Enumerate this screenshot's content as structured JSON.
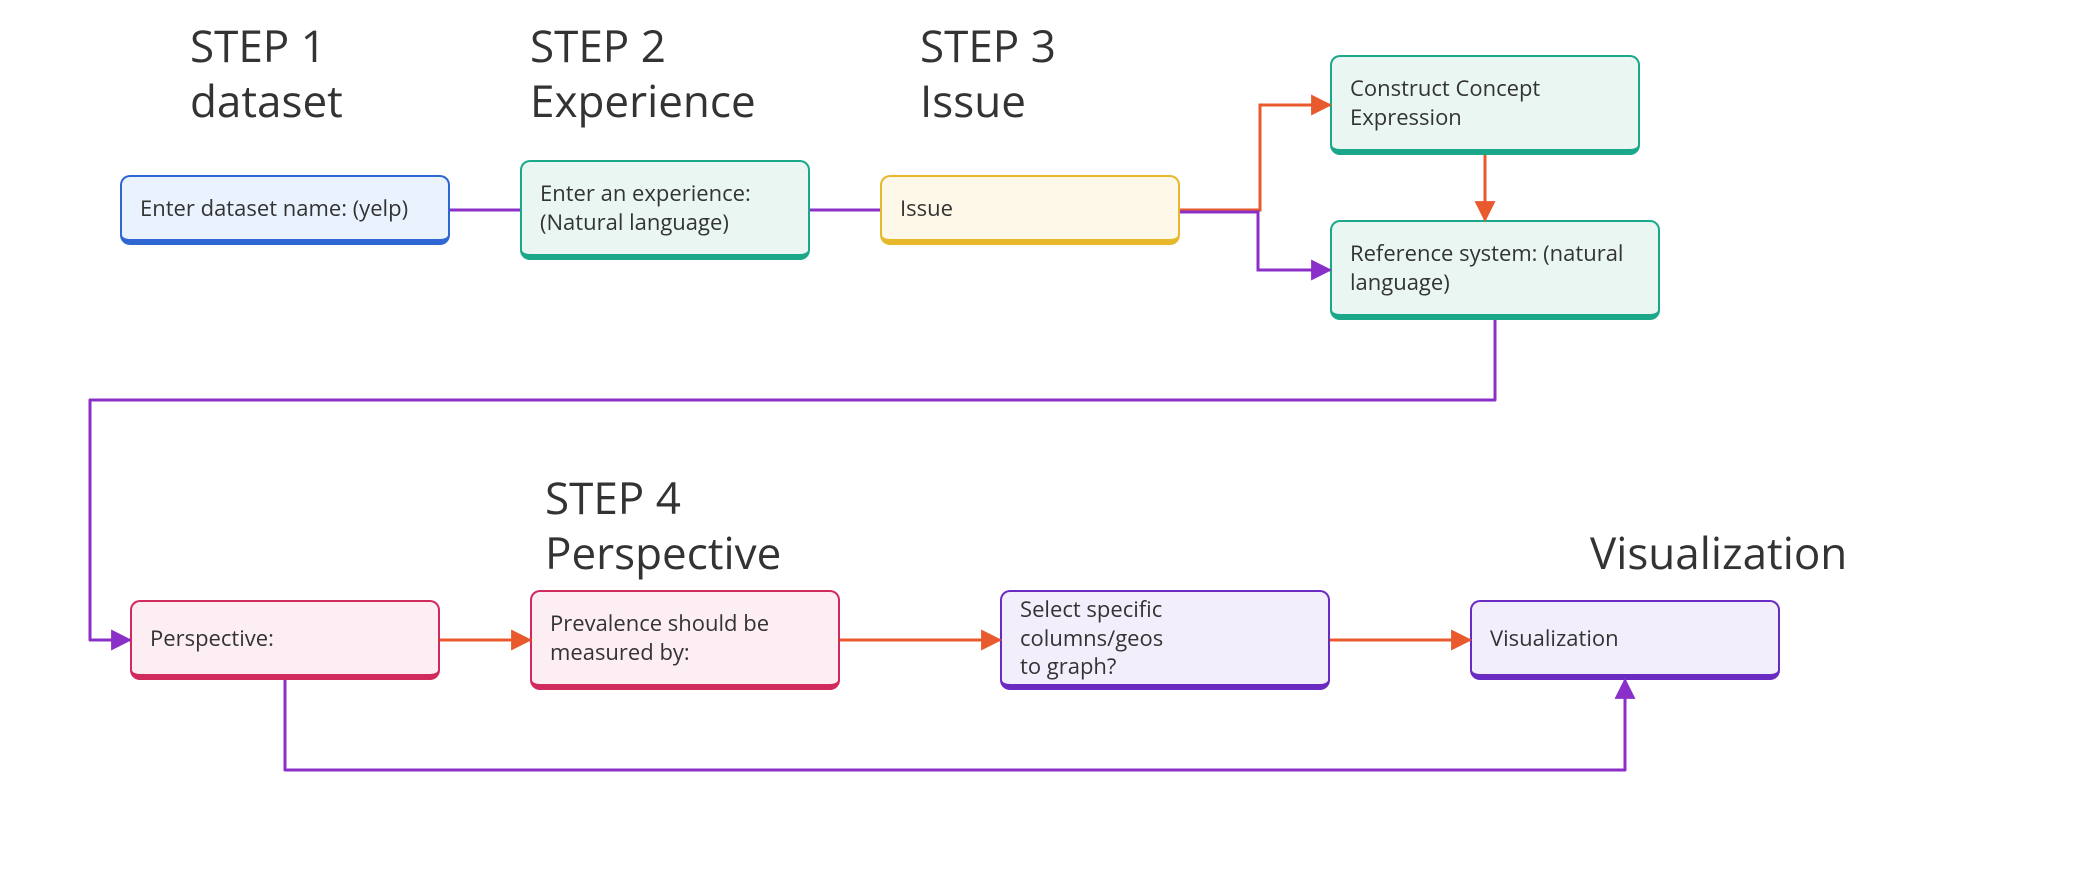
{
  "headings": {
    "step1": "STEP 1\ndataset",
    "step2": "STEP 2\nExperience",
    "step3": "STEP 3\nIssue",
    "step4": "STEP 4\nPerspective",
    "viz": "Visualization"
  },
  "boxes": {
    "dataset": "Enter dataset name:  (yelp)",
    "experience": "Enter an experience:\n(Natural language)",
    "issue": "Issue",
    "concept": "Construct Concept\nExpression",
    "reference": "Reference system: (natural\nlanguage)",
    "perspective": "Perspective:",
    "prevalence": "Prevalence should be\nmeasured by:",
    "columns": "Select specific columns/geos\nto graph?",
    "visualization": "Visualization"
  },
  "colors": {
    "purple_line": "#8b2fc9",
    "orange_line": "#e8592e"
  }
}
